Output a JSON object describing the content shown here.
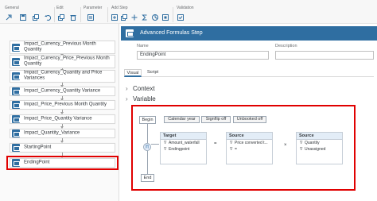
{
  "toolbar": {
    "groups": [
      "General",
      "Edit",
      "Parameter",
      "Add Step",
      "Validation"
    ]
  },
  "flow": {
    "items": [
      "Impact_Currency_Previous Month Quantity",
      "Impact_Currency_Price_Previous Month Quantity",
      "Impact_Currency_Quantity and Price Variances",
      "Impact_Currency_Quantity Variance",
      "Impact_Price_Previous Month Quantity",
      "Impact_Price_Quantity Variance",
      "Impact_Quantity_Variance",
      "StartingPoint",
      "EndingPoint"
    ]
  },
  "step": {
    "title": "Advanced Formulas Step",
    "name_label": "Name",
    "name_value": "EndingPoint",
    "description_label": "Description",
    "description_value": ""
  },
  "tabs": [
    "Visual",
    "Script"
  ],
  "sections": [
    "Context",
    "Variable"
  ],
  "canvas": {
    "begin": "Begin",
    "end": "End",
    "pills": [
      "Calendar year",
      "Signflip off",
      "Unbooked off"
    ],
    "op_symbol": "(f)",
    "target": {
      "title": "Target",
      "rows": [
        "Amount_waterfall",
        "Endingpoint"
      ]
    },
    "source1": {
      "title": "Source",
      "rows": [
        "Price converted t...",
        "="
      ]
    },
    "source2": {
      "title": "Source",
      "rows": [
        "Quantity",
        "Unassigned"
      ]
    },
    "eq": "=",
    "times": "×"
  },
  "colors": {
    "accent": "#2f6ea1",
    "highlight": "#e00000"
  }
}
